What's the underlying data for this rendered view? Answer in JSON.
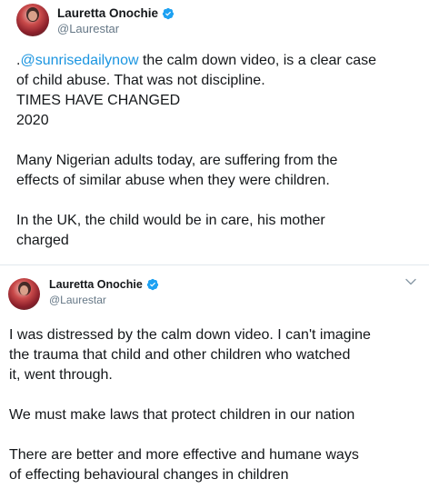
{
  "tweets": [
    {
      "author": {
        "display_name": "Lauretta Onochie",
        "handle": "@Laurestar",
        "verified": true
      },
      "body": {
        "mention_prefix": ".",
        "mention": "@sunrisedailynow",
        "line1_rest": " the calm down video, is a clear case",
        "line2": "of child abuse. That was not discipline.",
        "line3": "TIMES HAVE CHANGED",
        "line4": "2020",
        "line5": "Many Nigerian adults today, are suffering from the",
        "line6": "effects of similar abuse when they were children.",
        "line7": "In the UK, the child would be in care, his mother",
        "line8": "charged"
      }
    },
    {
      "author": {
        "display_name": "Lauretta Onochie",
        "handle": "@Laurestar",
        "verified": true
      },
      "body": {
        "line1": "I was distressed by the calm down video. I can't imagine",
        "line2": "the trauma that child and other children who watched",
        "line3": "it, went through.",
        "line4": "We must make laws that protect children in our nation",
        "line5": "There are better and more effective and humane ways",
        "line6": "of effecting behavioural changes in children"
      }
    }
  ],
  "icons": {
    "verified": "verified-badge-icon",
    "menu": "chevron-down-icon"
  },
  "colors": {
    "mention": "#1b95e0",
    "verified": "#1da1f2",
    "text": "#14171a",
    "muted": "#657786"
  }
}
